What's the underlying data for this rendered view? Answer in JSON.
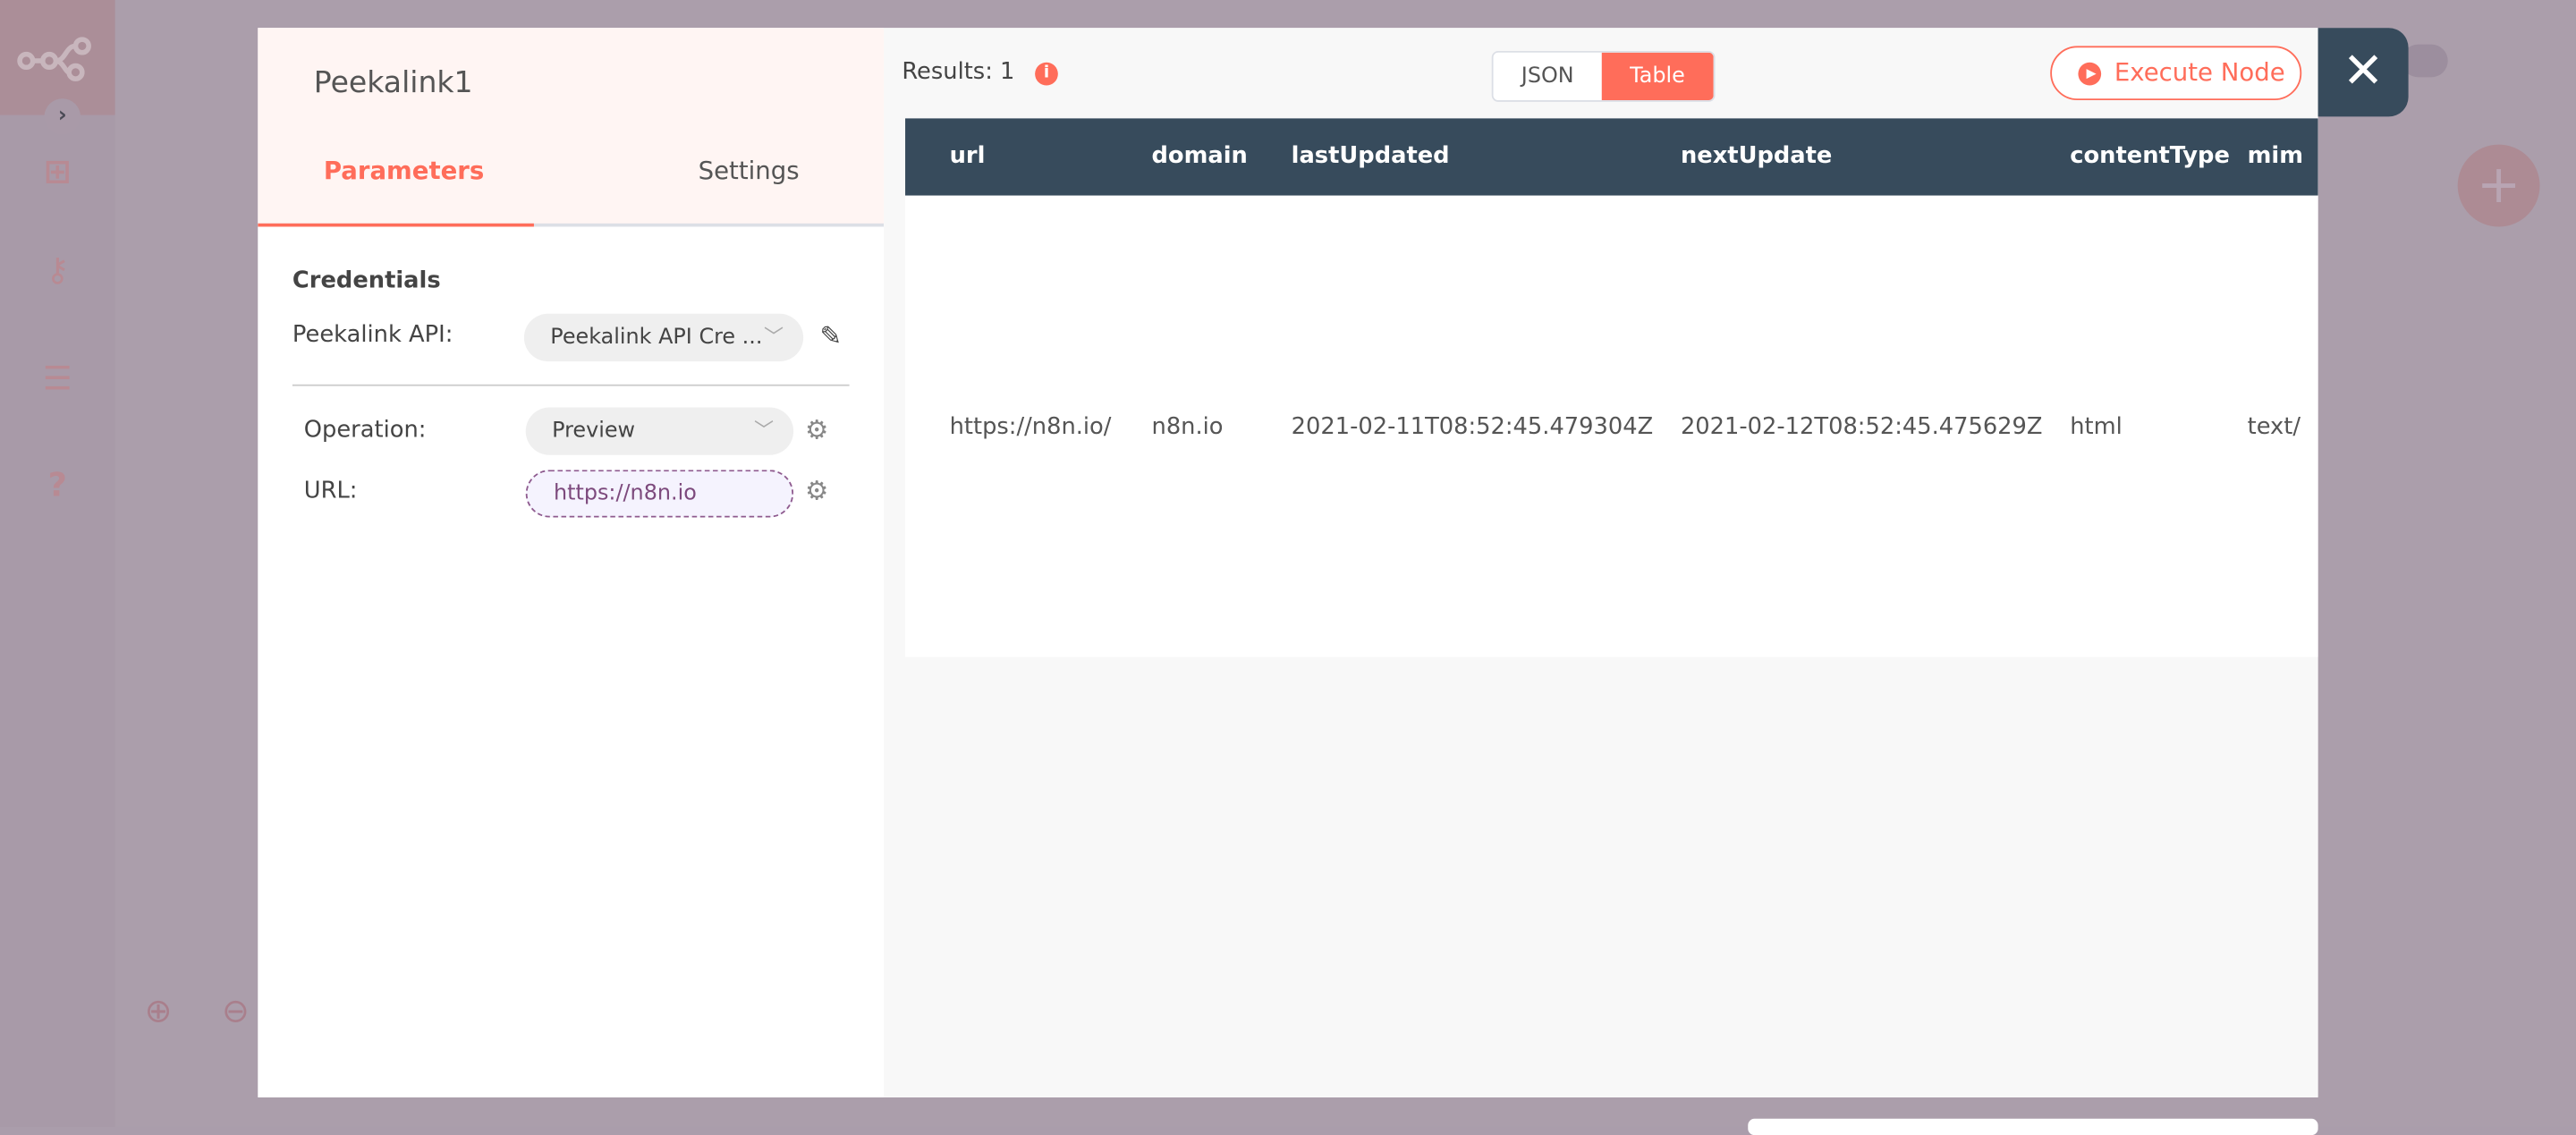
{
  "node": {
    "title": "Peekalink1"
  },
  "tabs": [
    {
      "label": "Parameters",
      "active": true
    },
    {
      "label": "Settings",
      "active": false
    }
  ],
  "parameters": {
    "credentials_heading": "Credentials",
    "credential_label": "Peekalink API:",
    "credential_value": "Peekalink API Cre  ...",
    "operation_label": "Operation:",
    "operation_value": "Preview",
    "url_label": "URL:",
    "url_value": "https://n8n.io"
  },
  "output": {
    "results_label": "Results: 1",
    "view_json": "JSON",
    "view_table": "Table",
    "active_view": "Table",
    "execute_label": "Execute Node",
    "columns": [
      "url",
      "domain",
      "lastUpdated",
      "nextUpdate",
      "contentType",
      "mim"
    ],
    "rows": [
      [
        "https://n8n.io/",
        "n8n.io",
        "2021-02-11T08:52:45.479304Z",
        "2021-02-12T08:52:45.475629Z",
        "html",
        "text/"
      ]
    ]
  },
  "colors": {
    "accent": "#ff6d5a",
    "header": "#374b5c"
  },
  "icons": {
    "close": "close-icon",
    "execute": "play-icon",
    "edit": "pencil-icon",
    "param-options": "gears-icon"
  }
}
